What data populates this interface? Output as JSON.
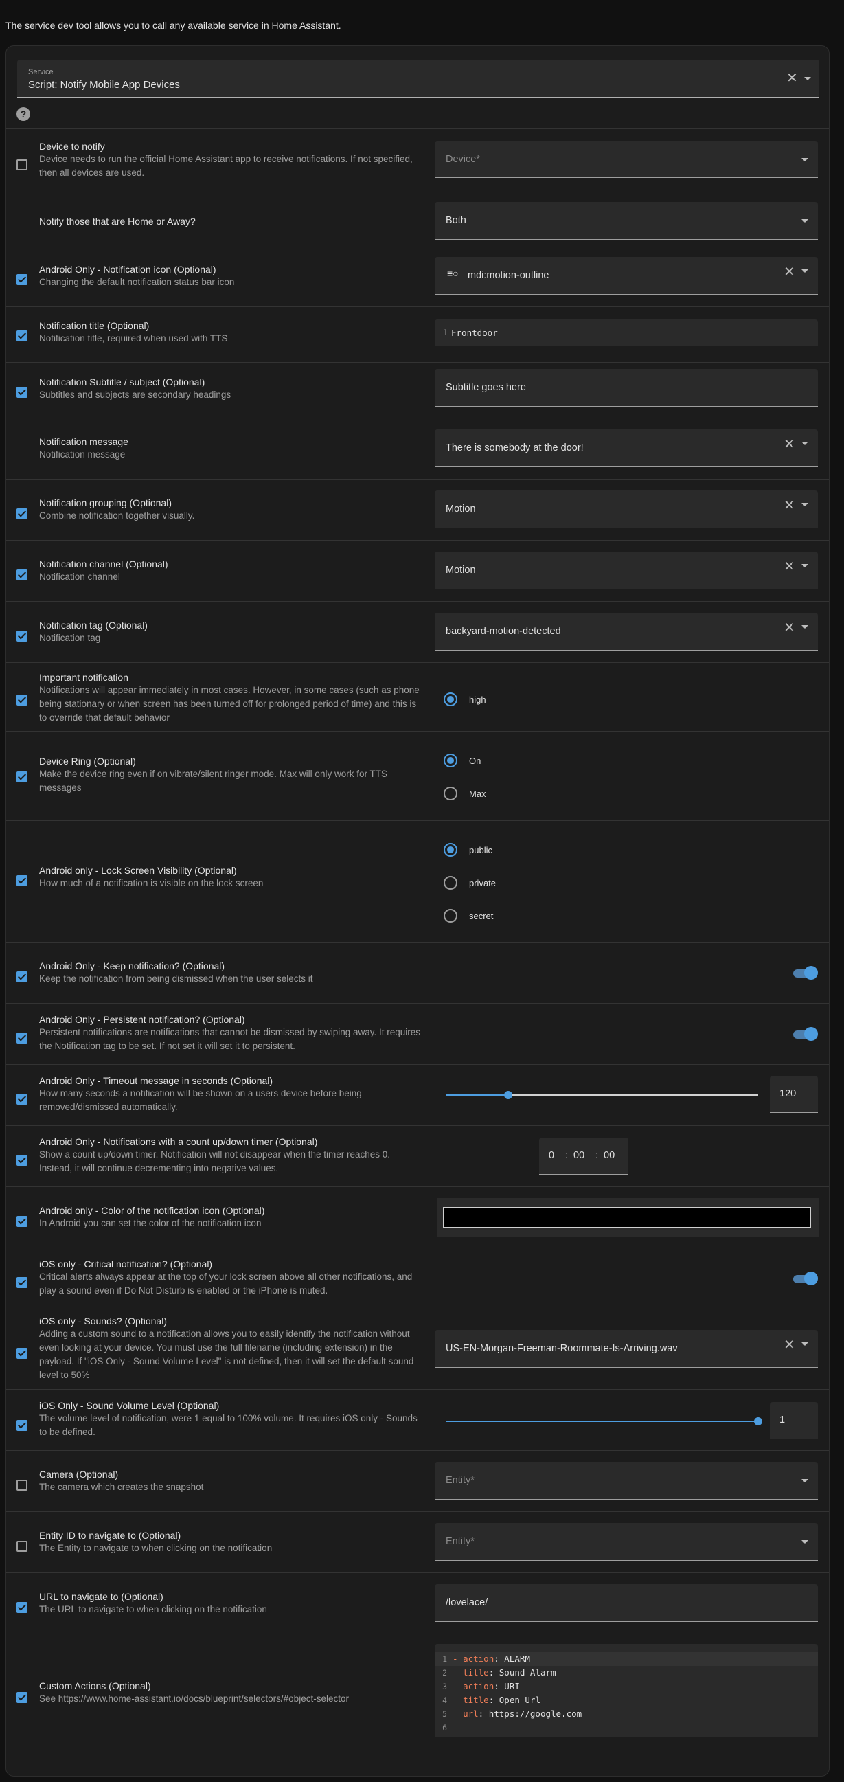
{
  "intro": "The service dev tool allows you to call any available service in Home Assistant.",
  "service": {
    "label": "Service",
    "value": "Script: Notify Mobile App Devices"
  },
  "accent_color": "#4d9de0",
  "rows": {
    "device": {
      "title": "Device to notify",
      "desc": "Device needs to run the official Home Assistant app to receive notifications. If not specified, then all devices are used.",
      "placeholder": "Device*",
      "checked": false
    },
    "home_away": {
      "title": "Notify those that are Home or Away?",
      "value": "Both"
    },
    "icon": {
      "title": "Android Only - Notification icon (Optional)",
      "desc": "Changing the default notification status bar icon",
      "value": "mdi:motion-outline",
      "icon_name": "motion-outline-icon",
      "checked": true
    },
    "title": {
      "title": "Notification title (Optional)",
      "desc": "Notification title, required when used with TTS",
      "line": "1",
      "value": "Frontdoor",
      "checked": true
    },
    "subtitle": {
      "title": "Notification Subtitle / subject (Optional)",
      "desc": "Subtitles and subjects are secondary headings",
      "value": "Subtitle goes here",
      "checked": true
    },
    "message": {
      "title": "Notification message",
      "desc": "Notification message",
      "value": "There is somebody at the door!"
    },
    "grouping": {
      "title": "Notification grouping (Optional)",
      "desc": "Combine notification together visually.",
      "value": "Motion",
      "checked": true
    },
    "channel": {
      "title": "Notification channel (Optional)",
      "desc": "Notification channel",
      "value": "Motion",
      "checked": true
    },
    "tag": {
      "title": "Notification tag (Optional)",
      "desc": "Notification tag",
      "value": "backyard-motion-detected",
      "checked": true
    },
    "important": {
      "title": "Important notification",
      "desc": "Notifications will appear immediately in most cases. However, in some cases (such as phone being stationary or when screen has been turned off for prolonged period of time) and this is to override that default behavior",
      "options": [
        "high"
      ],
      "selected": "high",
      "checked": true
    },
    "ring": {
      "title": "Device Ring (Optional)",
      "desc": "Make the device ring even if on vibrate/silent ringer mode. Max will only work for TTS messages",
      "options": [
        "On",
        "Max"
      ],
      "selected": "On",
      "checked": true
    },
    "visibility": {
      "title": "Android only - Lock Screen Visibility (Optional)",
      "desc": "How much of a notification is visible on the lock screen",
      "options": [
        "public",
        "private",
        "secret"
      ],
      "selected": "public",
      "checked": true
    },
    "keep": {
      "title": "Android Only - Keep notification? (Optional)",
      "desc": "Keep the notification from being dismissed when the user selects it",
      "toggle": true,
      "checked": true
    },
    "persistent": {
      "title": "Android Only - Persistent notification? (Optional)",
      "desc": "Persistent notifications are notifications that cannot be dismissed by swiping away. It requires the Notification tag to be set. If not set it will set it to persistent.",
      "toggle": true,
      "checked": true
    },
    "timeout": {
      "title": "Android Only - Timeout message in seconds (Optional)",
      "desc": "How many seconds a notification will be shown on a users device before being removed/dismissed automatically.",
      "value": "120",
      "slider_fraction": 0.2,
      "checked": true
    },
    "timer": {
      "title": "Android Only - Notifications with a count up/down timer (Optional)",
      "desc": "Show a count up/down timer. Notification will not disappear when the timer reaches 0. Instead, it will continue decrementing into negative values.",
      "hours": "0",
      "minutes": "00",
      "seconds": "00",
      "sep": ":",
      "checked": true
    },
    "color": {
      "title": "Android only - Color of the notification icon (Optional)",
      "desc": "In Android you can set the color of the notification icon",
      "value": "#000000",
      "checked": true
    },
    "critical": {
      "title": "iOS only - Critical notification? (Optional)",
      "desc": "Critical alerts always appear at the top of your lock screen above all other notifications, and play a sound even if Do Not Disturb is enabled or the iPhone is muted.",
      "toggle": true,
      "checked": true
    },
    "sounds": {
      "title": "iOS only - Sounds? (Optional)",
      "desc": "Adding a custom sound to a notification allows you to easily identify the notification without even looking at your device. You must use the full filename (including extension) in the payload. If \"iOS Only - Sound Volume Level\" is not defined, then it will set the default sound level to 50%",
      "value": "US-EN-Morgan-Freeman-Roommate-Is-Arriving.wav",
      "checked": true
    },
    "volume": {
      "title": "iOS Only - Sound Volume Level (Optional)",
      "desc": "The volume level of notification, were 1 equal to 100% volume. It requires iOS only - Sounds to be defined.",
      "value": "1",
      "slider_fraction": 1.0,
      "checked": true
    },
    "camera": {
      "title": "Camera (Optional)",
      "desc": "The camera which creates the snapshot",
      "placeholder": "Entity*",
      "checked": false
    },
    "entity_nav": {
      "title": "Entity ID to navigate to (Optional)",
      "desc": "The Entity to navigate to when clicking on the notification",
      "placeholder": "Entity*",
      "checked": false
    },
    "url": {
      "title": "URL to navigate to (Optional)",
      "desc": "The URL to navigate to when clicking on the notification",
      "value": "/lovelace/",
      "checked": true
    },
    "actions": {
      "title": "Custom Actions (Optional)",
      "desc": "See https://www.home-assistant.io/docs/blueprint/selectors/#object-selector",
      "checked": true,
      "code_lines": [
        {
          "n": "1",
          "prefix": "- ",
          "key": "action",
          "sep": ": ",
          "val": "ALARM"
        },
        {
          "n": "2",
          "prefix": "  ",
          "key": "title",
          "sep": ": ",
          "val": "Sound Alarm"
        },
        {
          "n": "3",
          "prefix": "- ",
          "key": "action",
          "sep": ": ",
          "val": "URI"
        },
        {
          "n": "4",
          "prefix": "  ",
          "key": "title",
          "sep": ": ",
          "val": "Open Url"
        },
        {
          "n": "5",
          "prefix": "  ",
          "key": "url",
          "sep": ": ",
          "val": "https://google.com"
        },
        {
          "n": "6",
          "prefix": "",
          "key": "",
          "sep": "",
          "val": ""
        }
      ]
    }
  }
}
